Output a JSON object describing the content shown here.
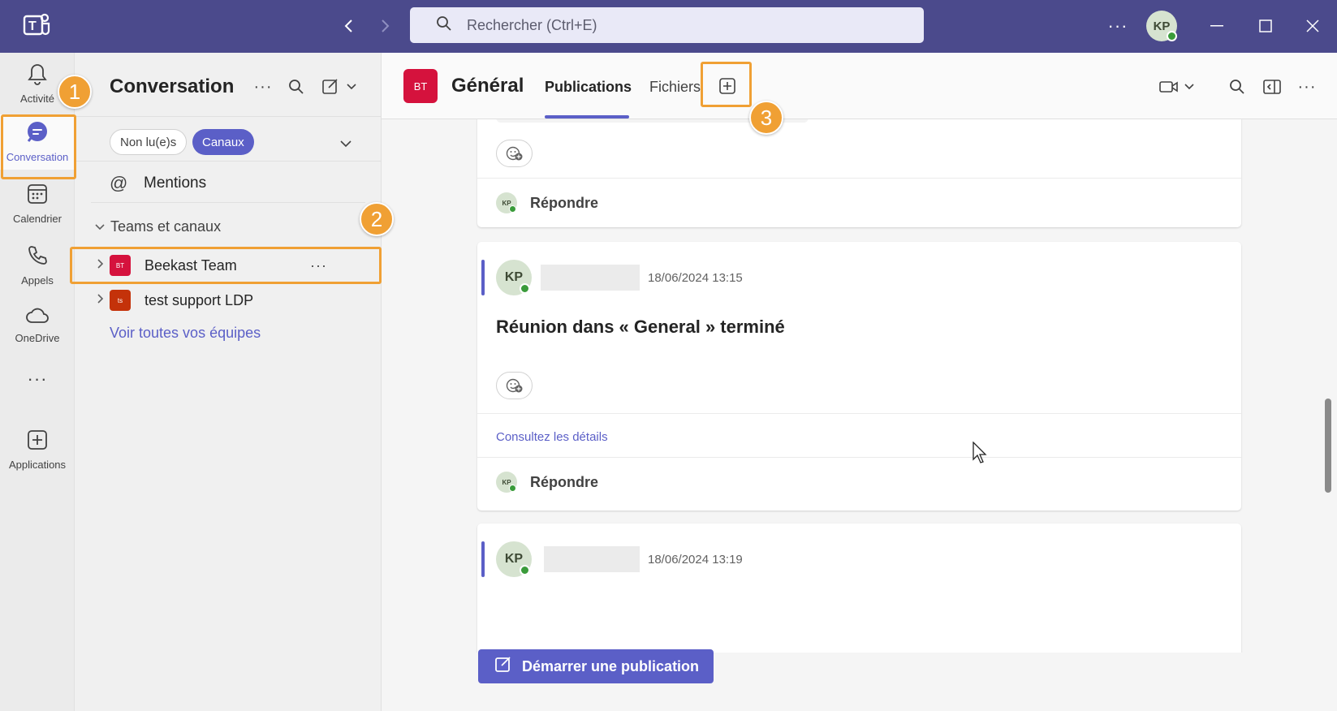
{
  "titlebar": {
    "search_placeholder": "Rechercher (Ctrl+E)",
    "user_initials": "KP"
  },
  "rail": {
    "items": [
      {
        "label": "Activité",
        "icon": "bell-icon"
      },
      {
        "label": "Conversation",
        "icon": "chat-icon",
        "active": true
      },
      {
        "label": "Calendrier",
        "icon": "calendar-icon"
      },
      {
        "label": "Appels",
        "icon": "phone-icon"
      },
      {
        "label": "OneDrive",
        "icon": "cloud-icon"
      },
      {
        "label": "",
        "icon": "more-icon"
      },
      {
        "label": "Applications",
        "icon": "plus-square-icon"
      }
    ]
  },
  "sidebar": {
    "title": "Conversation",
    "filters": {
      "unread": "Non lu(e)s",
      "channels": "Canaux"
    },
    "mentions": "Mentions",
    "section": "Teams et canaux",
    "teams": [
      {
        "initials": "BT",
        "name": "Beekast Team",
        "color": "#d5123d"
      },
      {
        "initials": "ts",
        "name": "test support LDP",
        "color": "#c4320a"
      }
    ],
    "see_all": "Voir toutes vos équipes"
  },
  "channel": {
    "initials": "BT",
    "name": "Général",
    "tabs": {
      "posts": "Publications",
      "files": "Fichiers"
    }
  },
  "feed": {
    "reply_label": "Répondre",
    "author_initials": "KP",
    "messages": [
      {
        "timestamp": "18/06/2024 13:15",
        "title": "Réunion dans « General » terminé",
        "link": "Consultez les détails"
      },
      {
        "timestamp": "18/06/2024 13:19"
      }
    ],
    "start_post": "Démarrer une publication"
  },
  "annotations": {
    "step1": "1",
    "step2": "2",
    "step3": "3"
  },
  "colors": {
    "accent": "#5b5fc7",
    "titlebar": "#4b4a8c",
    "highlight": "#f0a034"
  }
}
